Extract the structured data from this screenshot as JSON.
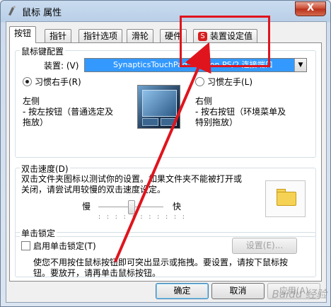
{
  "window": {
    "title": "鼠标 属性",
    "close": "X"
  },
  "tabs": [
    {
      "label": "按钮",
      "active": true
    },
    {
      "label": "指针"
    },
    {
      "label": "指针选项"
    },
    {
      "label": "滑轮"
    },
    {
      "label": "硬件"
    },
    {
      "label": "装置设定值",
      "icon": "synaptics-icon"
    }
  ],
  "button_config": {
    "group_title": "鼠标键配置",
    "device_label": "装置: (V)",
    "device_value": "SynapticsTouchPad V7.2 on PS/2 连接端口",
    "right_hand": {
      "label": "习惯右手(R)",
      "selected": true
    },
    "left_hand": {
      "label": "习惯左手(L)",
      "selected": false
    },
    "left_side_title": "左侧",
    "left_side_desc_1": "- 按左按钮（普通选定及",
    "left_side_desc_2": "拖放）",
    "right_side_title": "右侧",
    "right_side_desc_1": "- 按右按钮（环境菜单及",
    "right_side_desc_2": "特别拖放）"
  },
  "double_click": {
    "group_title": "双击速度(D)",
    "desc_1": "双击文件夹图标以测试你的设置。如果文件夹不能被打开或",
    "desc_2": "关闭，请尝试用较慢的双击速度设定。",
    "slow": "慢",
    "fast": "快",
    "speed_fraction": 0.5,
    "ticks": ": : : : : : : : : : :"
  },
  "click_lock": {
    "group_title": "单击锁定",
    "checkbox_label": "启用单击锁定(T)",
    "checked": false,
    "settings_button": "设置(E)...",
    "desc_1": "使您不用按住鼠标按钮即可突出显示或拖拽。要设置，请按下鼠标按",
    "desc_2": "钮。要放开，请再单击鼠标按钮。"
  },
  "footer": {
    "ok": "确定",
    "cancel": "取消",
    "apply": "应用(A)"
  },
  "annotation": {
    "color": "#e0141d"
  },
  "watermark": "Baidu 经验"
}
